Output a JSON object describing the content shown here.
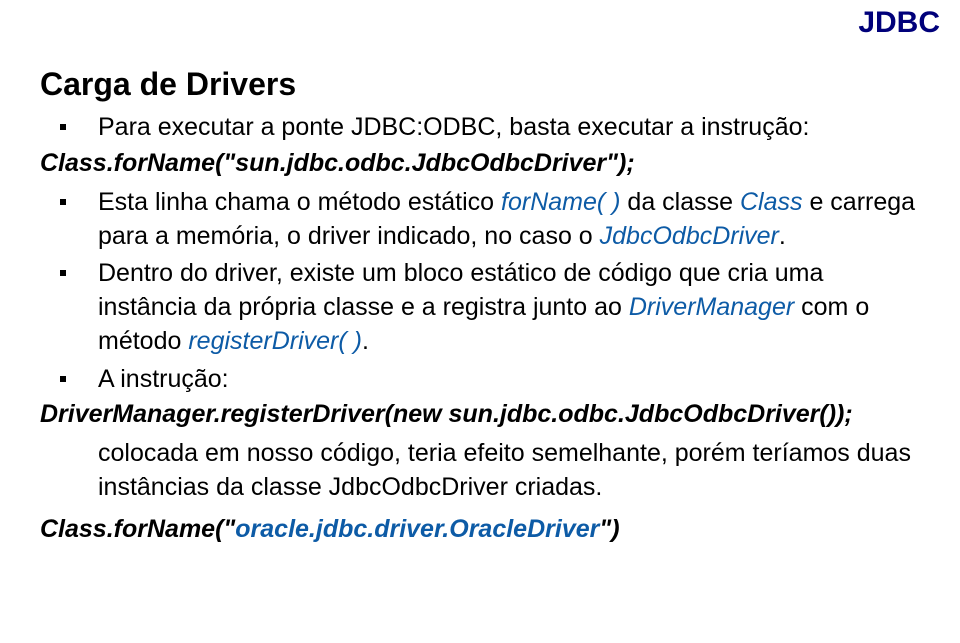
{
  "topLabel": "JDBC",
  "heading": "Carga de Drivers",
  "b1": "Para executar a ponte JDBC:ODBC, basta executar a instrução:",
  "line1": "Class.forName(\"sun.jdbc.odbc.JdbcOdbcDriver\");",
  "b2_pre": "Esta linha chama o método estático ",
  "b2_forName": "forName( )",
  "b2_mid": " da classe ",
  "b2_class": "Class",
  "b2_mid2": " e carrega para a memória, o driver indicado, no caso o ",
  "b2_odbc": "JdbcOdbcDriver",
  "b2_end": ".",
  "b3_pre": "Dentro do driver, existe um bloco estático de código que cria uma instância da própria classe e a registra junto ao ",
  "b3_dm": "DriverManager",
  "b3_mid": " com o método ",
  "b3_reg": "registerDriver( )",
  "b3_end": ".",
  "b4": "A instrução:",
  "line2": "DriverManager.registerDriver(new sun.jdbc.odbc.JdbcOdbcDriver());",
  "sub1": "colocada em nosso código, teria efeito semelhante, porém teríamos duas instâncias da classe JdbcOdbcDriver criadas.",
  "line3_a": "Class.forName(\"",
  "line3_b": "oracle.jdbc.driver.OracleDriver",
  "line3_c": "\")"
}
